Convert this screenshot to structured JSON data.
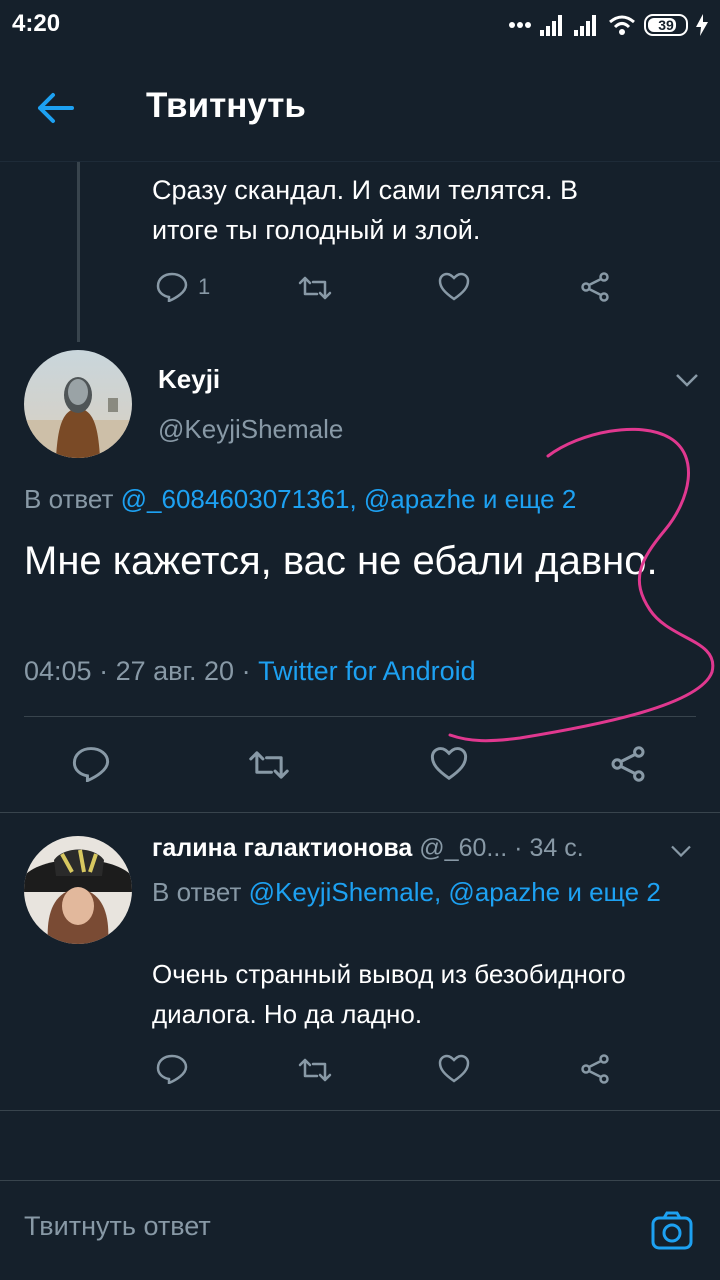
{
  "status_bar": {
    "time": "4:20",
    "battery": "39"
  },
  "header": {
    "title": "Твитнуть"
  },
  "previous_tweet": {
    "text_line_1": "Сразу скандал. И сами телятся. В",
    "text_line_2": "итоге ты голодный и злой.",
    "reply_count": "1"
  },
  "main_tweet": {
    "name": "Keyji",
    "handle": "@KeyjiShemale",
    "reply_prefix": "В ответ ",
    "reply_targets": "@_6084603071361, @apazhe и еще 2",
    "text": "Мне кажется, вас не ебали давно.",
    "time": "04:05",
    "date": "27 авг. 20",
    "source": "Twitter for Android"
  },
  "reply_tweet": {
    "name": "галина галактионова",
    "handle": "@_60...",
    "time": "· 34 с.",
    "reply_prefix": "В ответ ",
    "reply_targets": "@KeyjiShemale, @apazhe и еще 2",
    "text": "Очень странный вывод из безобидного диалога. Но да ладно."
  },
  "compose": {
    "placeholder": "Твитнуть ответ"
  },
  "colors": {
    "background": "#15202b",
    "accent": "#1da1f2",
    "muted": "#8899a6",
    "annotation": "#e0388f"
  }
}
